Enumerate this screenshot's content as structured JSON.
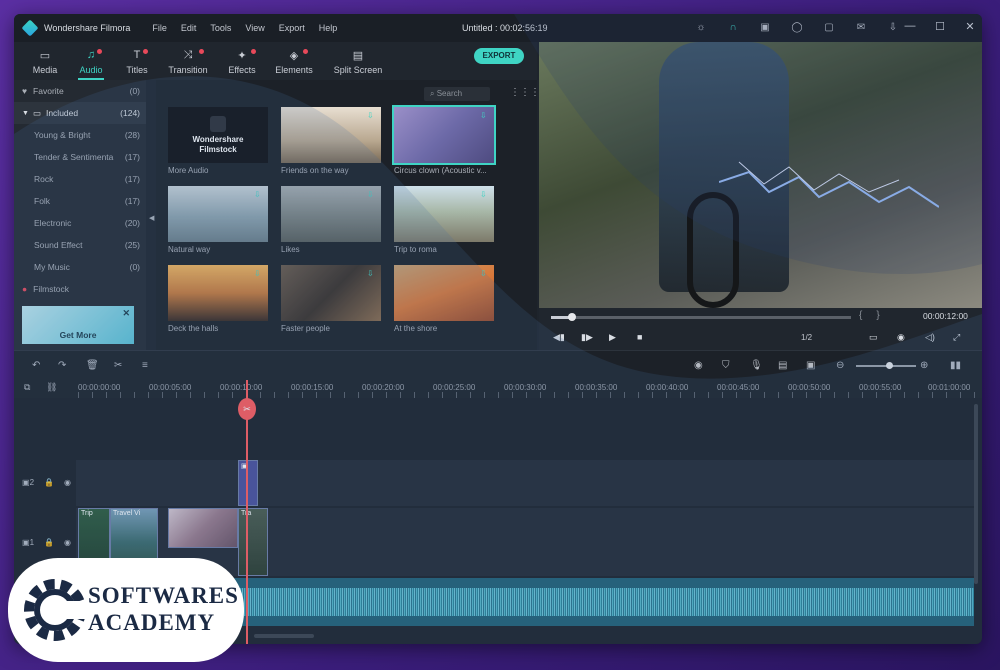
{
  "titlebar": {
    "app_name": "Wondershare Filmora",
    "menu": [
      "File",
      "Edit",
      "Tools",
      "View",
      "Export",
      "Help"
    ],
    "project_title": "Untitled : 00:02:56:19",
    "window_buttons": [
      "—",
      "☐",
      "✕"
    ]
  },
  "toolbar": {
    "tabs": [
      {
        "label": "Media",
        "icon": "folder-icon",
        "glyph": "▭"
      },
      {
        "label": "Audio",
        "icon": "music-note-icon",
        "glyph": "♫"
      },
      {
        "label": "Titles",
        "icon": "text-icon",
        "glyph": "T"
      },
      {
        "label": "Transition",
        "icon": "transition-icon",
        "glyph": "⤨"
      },
      {
        "label": "Effects",
        "icon": "effects-icon",
        "glyph": "✦"
      },
      {
        "label": "Elements",
        "icon": "elements-icon",
        "glyph": "◈"
      },
      {
        "label": "Split Screen",
        "icon": "split-screen-icon",
        "glyph": "▤"
      }
    ],
    "export_label": "EXPORT"
  },
  "sidebar": {
    "favorite": {
      "label": "Favorite",
      "count": "(0)"
    },
    "included": {
      "label": "Included",
      "count": "(124)"
    },
    "items": [
      {
        "label": "Young & Bright",
        "count": "(28)"
      },
      {
        "label": "Tender & Sentimenta",
        "count": "(17)"
      },
      {
        "label": "Rock",
        "count": "(17)"
      },
      {
        "label": "Folk",
        "count": "(17)"
      },
      {
        "label": "Electronic",
        "count": "(20)"
      },
      {
        "label": "Sound Effect",
        "count": "(25)"
      },
      {
        "label": "My Music",
        "count": "(0)"
      }
    ],
    "filmstock": "Filmstock",
    "get_more": "Get More"
  },
  "media": {
    "search_placeholder": "Search",
    "filmstock_title": "Wondershare Filmstock",
    "tiles": [
      {
        "caption": "More Audio"
      },
      {
        "caption": "Friends on the way"
      },
      {
        "caption": "Circus clown (Acoustic v..."
      },
      {
        "caption": "Natural way"
      },
      {
        "caption": "Likes"
      },
      {
        "caption": "Trip to roma"
      },
      {
        "caption": "Deck the halls"
      },
      {
        "caption": "Faster people"
      },
      {
        "caption": "At the shore"
      }
    ]
  },
  "preview": {
    "timecode": "00:00:12:00",
    "ratio": "1/2",
    "progress": 0.07
  },
  "timeline": {
    "ruler": [
      "00:00:00:00",
      "00:00:05:00",
      "00:00:10:00",
      "00:00:15:00",
      "00:00:20:00",
      "00:00:25:00",
      "00:00:30:00",
      "00:00:35:00",
      "00:00:40:00",
      "00:00:45:00",
      "00:00:50:00",
      "00:00:55:00",
      "00:01:00:00"
    ],
    "clips": [
      "Trip",
      "Travel Vi",
      "Tra"
    ],
    "track2_label": "2",
    "track1_label": "1"
  },
  "watermark": {
    "line1": "SOFTWARES",
    "line2": "ACADEMY"
  },
  "colors": {
    "accent": "#3fd4c4",
    "playhead": "#ff5a5a",
    "background": "#4a2a8a"
  }
}
